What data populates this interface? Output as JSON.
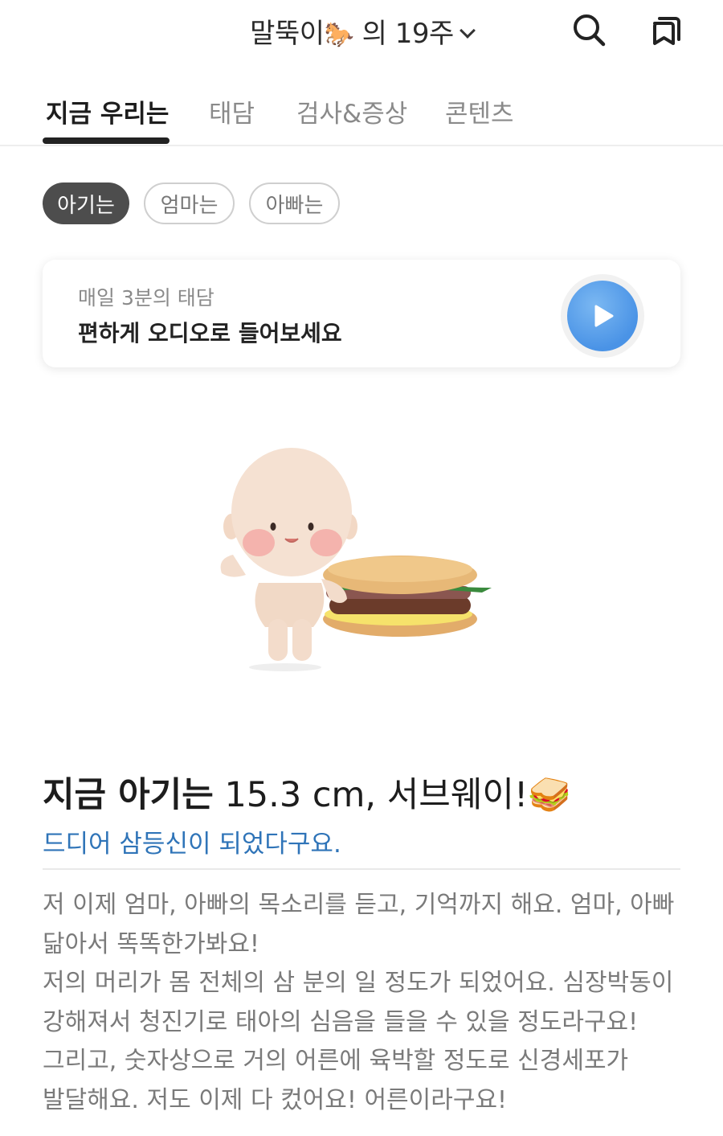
{
  "header": {
    "title_prefix": "말뚝이",
    "title_emoji": "🐎",
    "title_suffix": " 의 19주",
    "search_icon": "search-icon",
    "library_icon": "copy-stack-icon"
  },
  "tabs": [
    {
      "label": "지금 우리는",
      "active": true
    },
    {
      "label": "태담",
      "active": false
    },
    {
      "label": "검사&증상",
      "active": false
    },
    {
      "label": "콘텐츠",
      "active": false
    }
  ],
  "chips": [
    {
      "label": "아기는",
      "active": true
    },
    {
      "label": "엄마는",
      "active": false
    },
    {
      "label": "아빠는",
      "active": false
    }
  ],
  "audio_card": {
    "subtitle": "매일 3분의 태담",
    "title": "편하게 오디오로 들어보세요",
    "play_icon": "play-icon",
    "accent_color": "#4a93e6"
  },
  "illustration": {
    "name": "baby-with-sandwich-illustration"
  },
  "info": {
    "heading_strong": "지금 아기는",
    "heading_value": "15.3 cm, 서브웨이!",
    "heading_emoji": "🥪",
    "subheading": "드디어 삼등신이 되었다구요.",
    "subheading_color": "#2f74b8",
    "body": "저 이제 엄마, 아빠의 목소리를 듣고, 기억까지 해요. 엄마, 아빠 닮아서 똑똑한가봐요!\n저의 머리가 몸 전체의 삼 분의 일 정도가 되었어요. 심장박동이 강해져서 청진기로 태아의 심음을 들을 수 있을 정도라구요! 그리고, 숫자상으로 거의 어른에 육박할 정도로 신경세포가 발달해요. 저도 이제 다 컸어요! 어른이라구요!"
  }
}
